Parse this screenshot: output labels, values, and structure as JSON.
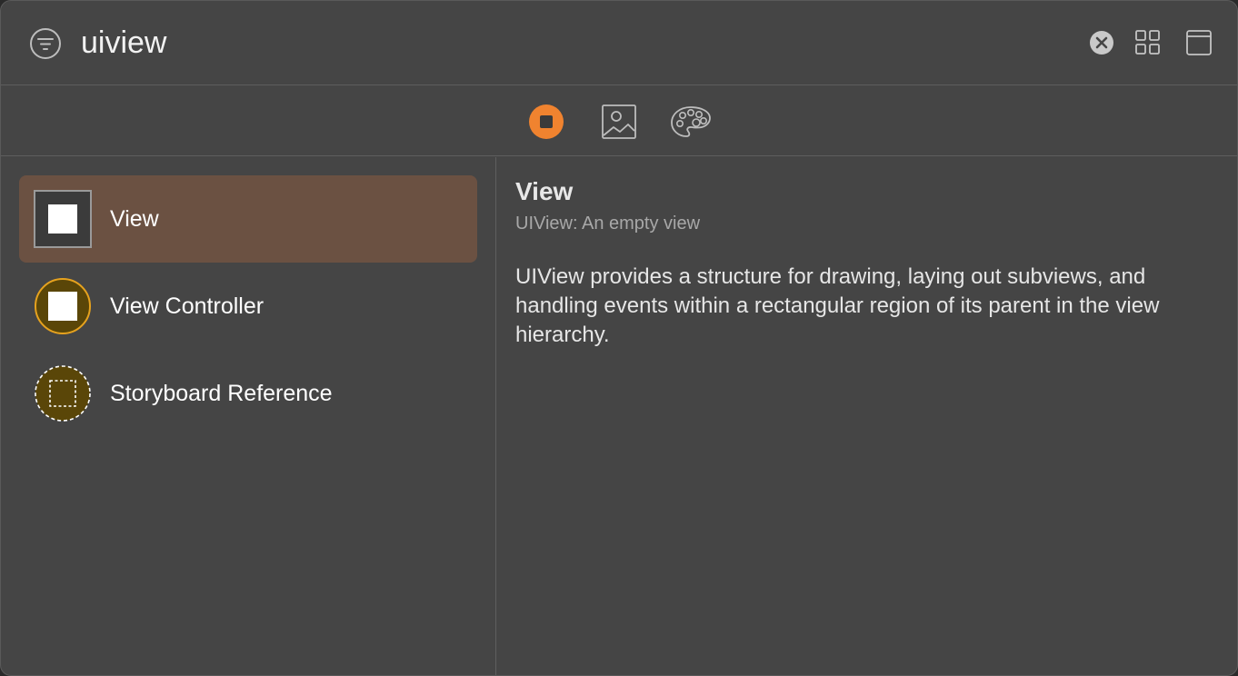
{
  "search": {
    "value": "uiview",
    "icons": {
      "filter": "filter-circle-icon",
      "clear": "clear-circle-x-icon",
      "grid": "grid-view-icon",
      "panel": "detail-panel-icon"
    }
  },
  "tabs": [
    {
      "label": "Objects",
      "icon": "objects-square-circle-icon",
      "selected": true,
      "color": "#F0832F"
    },
    {
      "label": "Media",
      "icon": "image-icon",
      "selected": false
    },
    {
      "label": "Colors",
      "icon": "palette-icon",
      "selected": false
    }
  ],
  "list": {
    "items": [
      {
        "label": "View",
        "icon": "view-square-icon",
        "selected": true
      },
      {
        "label": "View Controller",
        "icon": "view-controller-circle-icon",
        "selected": false
      },
      {
        "label": "Storyboard Reference",
        "icon": "storyboard-reference-dashed-icon",
        "selected": false
      }
    ]
  },
  "detail": {
    "title": "View",
    "subtitle": "UIView: An empty view",
    "description": "UIView provides a structure for drawing, laying out subviews, and handling events within a rectangular region of its parent in the view hierarchy."
  },
  "colors": {
    "selection": "#6B5142",
    "accent": "#F0832F",
    "controller_gold": "#E6A21E"
  }
}
